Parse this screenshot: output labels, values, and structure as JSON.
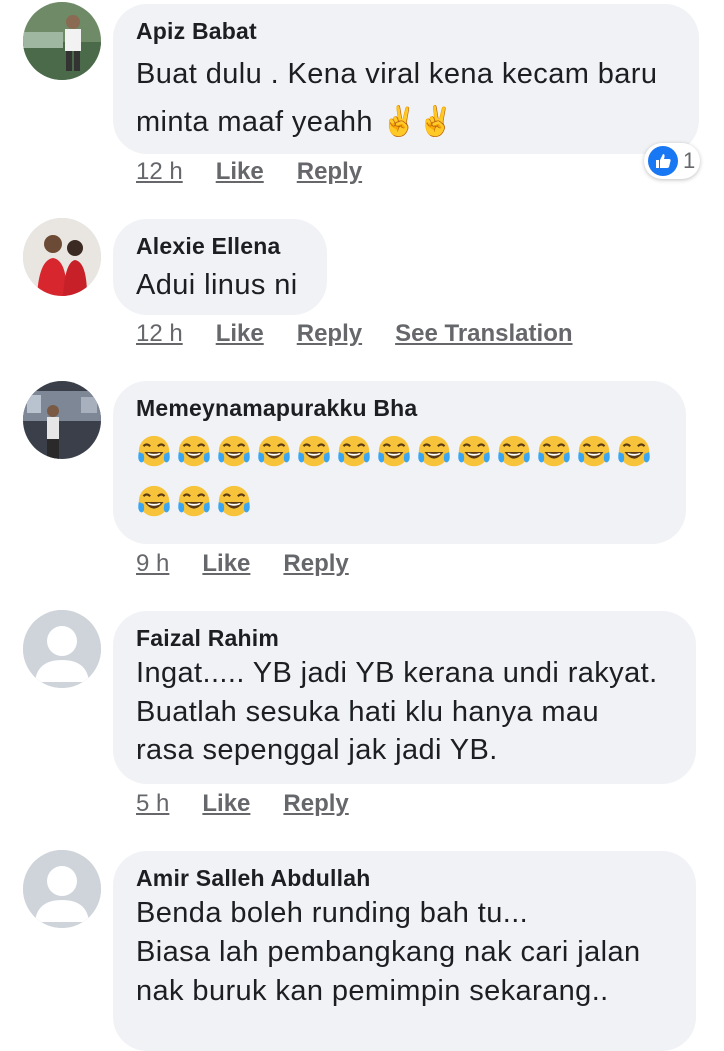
{
  "comments": [
    {
      "author": "Apiz Babat",
      "lines": [
        "Buat dulu . Kena viral kena kecam baru",
        "minta maaf yeahh ✌️✌️"
      ],
      "time": "12 h",
      "like": "Like",
      "reply": "Reply",
      "reaction": {
        "icon": "like-icon",
        "count": "1"
      }
    },
    {
      "author": "Alexie Ellena",
      "lines": [
        "Adui linus ni"
      ],
      "time": "12 h",
      "like": "Like",
      "reply": "Reply",
      "see_translation": "See Translation"
    },
    {
      "author": "Memeynamapurakku Bha",
      "emoji_icon": "face-with-tears-of-joy-icon",
      "emoji_rows": [
        13,
        3
      ],
      "time": "9 h",
      "like": "Like",
      "reply": "Reply"
    },
    {
      "author": "Faizal Rahim",
      "lines": [
        "Ingat..... YB jadi YB kerana undi rakyat.",
        "Buatlah sesuka hati klu hanya mau",
        "rasa sepenggal jak jadi YB."
      ],
      "time": "5 h",
      "like": "Like",
      "reply": "Reply"
    },
    {
      "author": "Amir Salleh Abdullah",
      "lines": [
        "Benda boleh runding bah tu...",
        "Biasa lah pembangkang nak cari jalan",
        "nak buruk kan pemimpin sekarang.."
      ]
    }
  ],
  "colors": {
    "bubble": "#f0f2f5",
    "link": "#65676b",
    "like_badge": "#1877f2"
  }
}
